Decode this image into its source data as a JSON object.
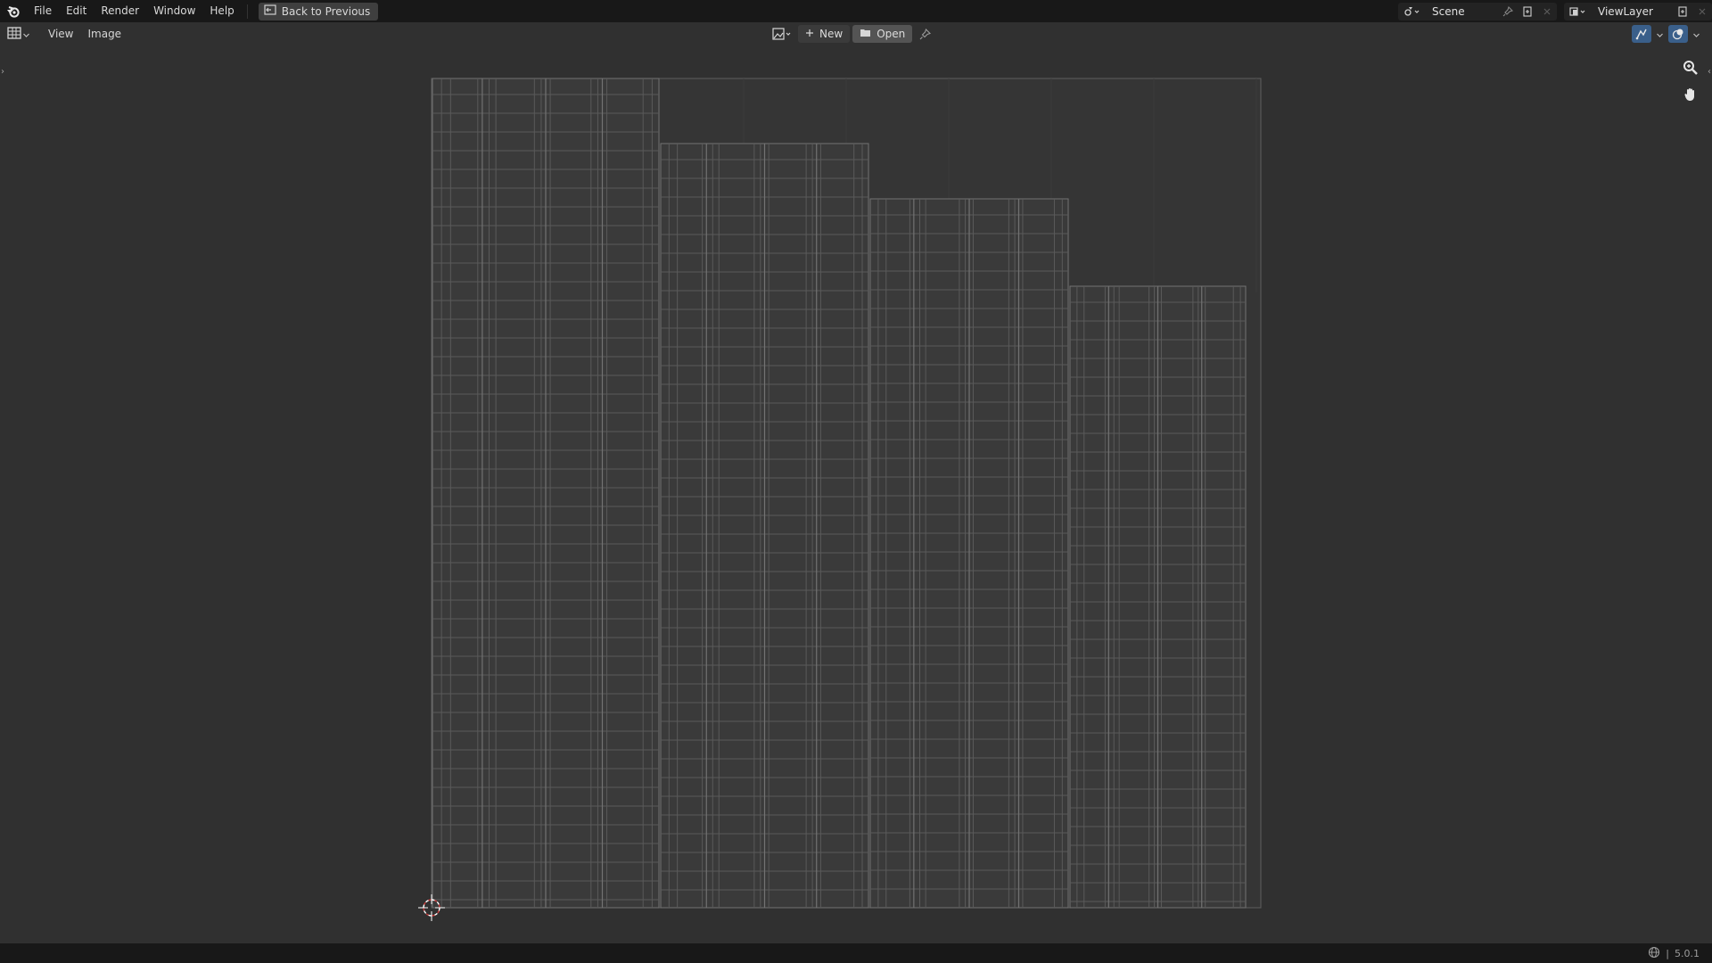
{
  "app": {
    "logo_icon": "blender-logo-icon"
  },
  "topbar": {
    "menus": [
      "File",
      "Edit",
      "Render",
      "Window",
      "Help"
    ],
    "back_label": "Back to Previous",
    "scene": {
      "value": "Scene"
    },
    "view_layer": {
      "value": "ViewLayer"
    }
  },
  "header": {
    "menus": [
      "View",
      "Image"
    ],
    "new_label": "New",
    "open_label": "Open"
  },
  "status": {
    "version": "5.0.1"
  },
  "colors": {
    "uv_line": "#5a5a5a",
    "uv_line_strong": "#727272",
    "accent_blue": "#3a5f8a",
    "cursor_red": "#c83a3a"
  }
}
